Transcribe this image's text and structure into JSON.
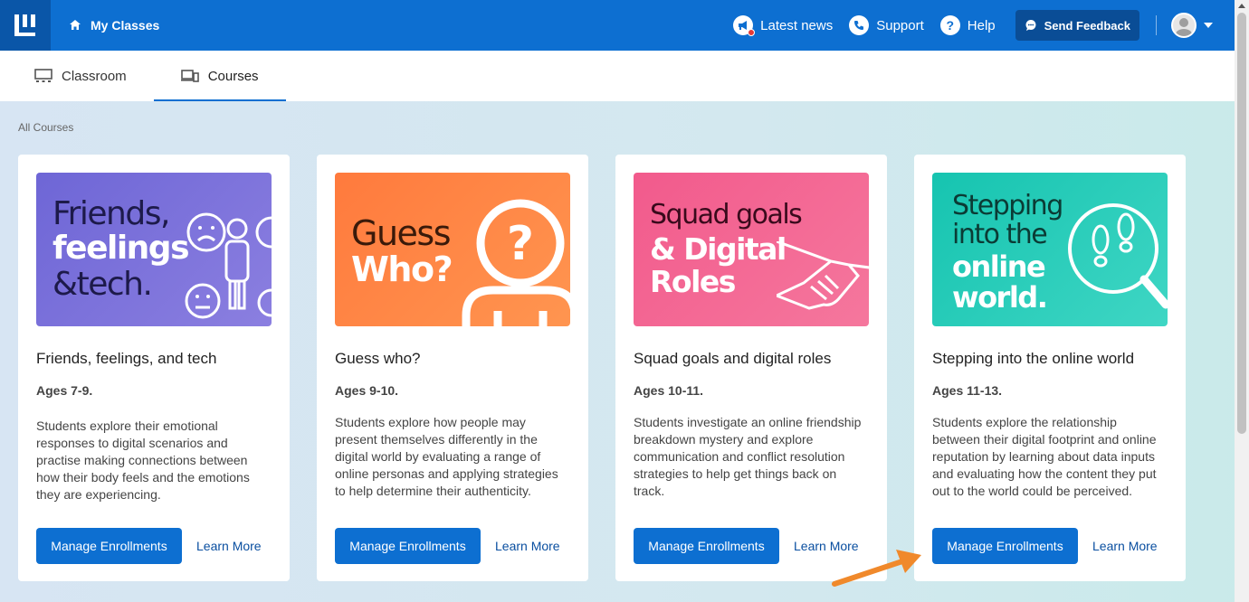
{
  "topbar": {
    "home_label": "My Classes",
    "links": [
      {
        "label": "Latest news",
        "icon": "megaphone-icon"
      },
      {
        "label": "Support",
        "icon": "phone-icon"
      },
      {
        "label": "Help",
        "icon": "help-icon"
      }
    ],
    "feedback_label": "Send Feedback",
    "accent_color": "#0d6fd1"
  },
  "tabs": [
    {
      "label": "Classroom",
      "icon": "classroom-icon",
      "active": false
    },
    {
      "label": "Courses",
      "icon": "devices-icon",
      "active": true
    }
  ],
  "breadcrumb": "All Courses",
  "cards": [
    {
      "banner_lines": [
        "Friends,",
        "feelings",
        "&tech."
      ],
      "title": "Friends, feelings, and tech",
      "ages": "Ages 7-9.",
      "description": "Students explore their emotional responses to digital scenarios and practise making connections between how their body feels and the emotions they are experiencing.",
      "primary_label": "Manage Enrollments",
      "secondary_label": "Learn More"
    },
    {
      "banner_lines": [
        "Guess",
        "Who?"
      ],
      "title": "Guess who?",
      "ages": "Ages 9-10.",
      "description": "Students explore how people may present themselves differently in the digital world by evaluating a range of online personas and applying strategies to help determine their authenticity.",
      "primary_label": "Manage Enrollments",
      "secondary_label": "Learn More"
    },
    {
      "banner_lines": [
        "Squad goals",
        "& Digital",
        "Roles"
      ],
      "title": "Squad goals and digital roles",
      "ages": "Ages 10-11.",
      "description": "Students investigate an online friendship breakdown mystery and explore communication and conflict resolution strategies to help get things back on track.",
      "primary_label": "Manage Enrollments",
      "secondary_label": "Learn More"
    },
    {
      "banner_lines": [
        "Stepping",
        "into the",
        "online",
        "world."
      ],
      "title": "Stepping into the online world",
      "ages": "Ages 11-13.",
      "description": "Students explore the relationship between their digital footprint and online reputation by learning about data inputs and evaluating how the content they put out to the world could be perceived.",
      "primary_label": "Manage Enrollments",
      "secondary_label": "Learn More"
    }
  ]
}
